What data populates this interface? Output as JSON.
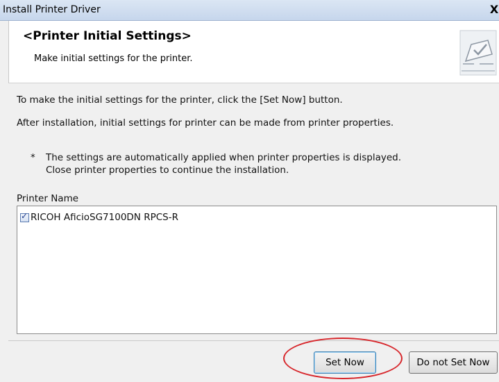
{
  "window": {
    "title": "Install Printer Driver",
    "close_glyph": "X"
  },
  "header": {
    "title": "<Printer Initial Settings>",
    "subtitle": "Make initial settings for the printer.",
    "icon": "printer-settings-icon"
  },
  "body": {
    "line1": "To make the initial settings for the printer, click the [Set Now] button.",
    "line2": "After installation, initial settings for printer can be made from printer properties.",
    "note_marker": "*",
    "note_line1": "The settings are automatically applied when printer properties is displayed.",
    "note_line2": "Close printer properties to continue the installation."
  },
  "printer_list": {
    "label": "Printer Name",
    "items": [
      {
        "name": "RICOH AficioSG7100DN RPCS-R",
        "checked": true
      }
    ]
  },
  "buttons": {
    "set_now": "Set Now",
    "do_not_set_now": "Do not Set Now"
  },
  "annotation": {
    "color": "#d7262b",
    "target": "set-now-button"
  }
}
